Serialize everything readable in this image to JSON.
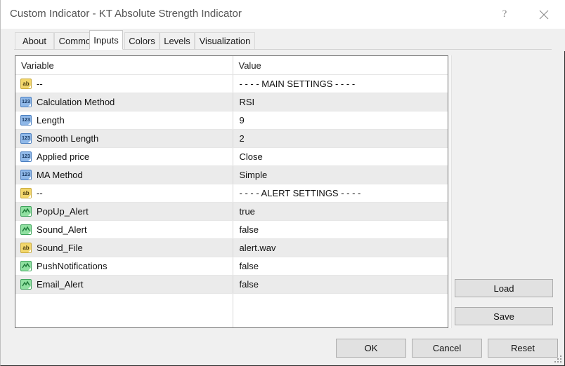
{
  "window": {
    "title": "Custom Indicator - KT Absolute Strength Indicator",
    "help_label": "?",
    "close_icon": "close-icon"
  },
  "tabs": [
    {
      "label": "About",
      "active": false
    },
    {
      "label": "Common",
      "active": false
    },
    {
      "label": "Inputs",
      "active": true
    },
    {
      "label": "Colors",
      "active": false
    },
    {
      "label": "Levels",
      "active": false
    },
    {
      "label": "Visualization",
      "active": false
    }
  ],
  "table": {
    "headers": {
      "variable": "Variable",
      "value": "Value"
    },
    "rows": [
      {
        "icon": "ab",
        "variable": "--",
        "value": "- - - - MAIN SETTINGS - - - -"
      },
      {
        "icon": "123",
        "variable": "Calculation Method",
        "value": "RSI"
      },
      {
        "icon": "123",
        "variable": "Length",
        "value": "9"
      },
      {
        "icon": "123",
        "variable": "Smooth Length",
        "value": "2"
      },
      {
        "icon": "123",
        "variable": "Applied price",
        "value": "Close"
      },
      {
        "icon": "123",
        "variable": "MA Method",
        "value": "Simple"
      },
      {
        "icon": "ab",
        "variable": "--",
        "value": "- - - - ALERT SETTINGS - - - -"
      },
      {
        "icon": "bool",
        "variable": "PopUp_Alert",
        "value": "true"
      },
      {
        "icon": "bool",
        "variable": "Sound_Alert",
        "value": "false"
      },
      {
        "icon": "ab",
        "variable": "Sound_File",
        "value": "alert.wav"
      },
      {
        "icon": "bool",
        "variable": "PushNotifications",
        "value": "false"
      },
      {
        "icon": "bool",
        "variable": "Email_Alert",
        "value": "false"
      }
    ]
  },
  "side_buttons": {
    "load": "Load",
    "save": "Save"
  },
  "footer_buttons": {
    "ok": "OK",
    "cancel": "Cancel",
    "reset": "Reset"
  },
  "colors": {
    "accent_red": "#c0392b",
    "icon_string": "#f2d66b",
    "icon_number": "#8fb8e8",
    "icon_bool": "#8fe0a0",
    "row_alt": "#ebebeb",
    "dialog_bg": "#f0f0f0"
  }
}
